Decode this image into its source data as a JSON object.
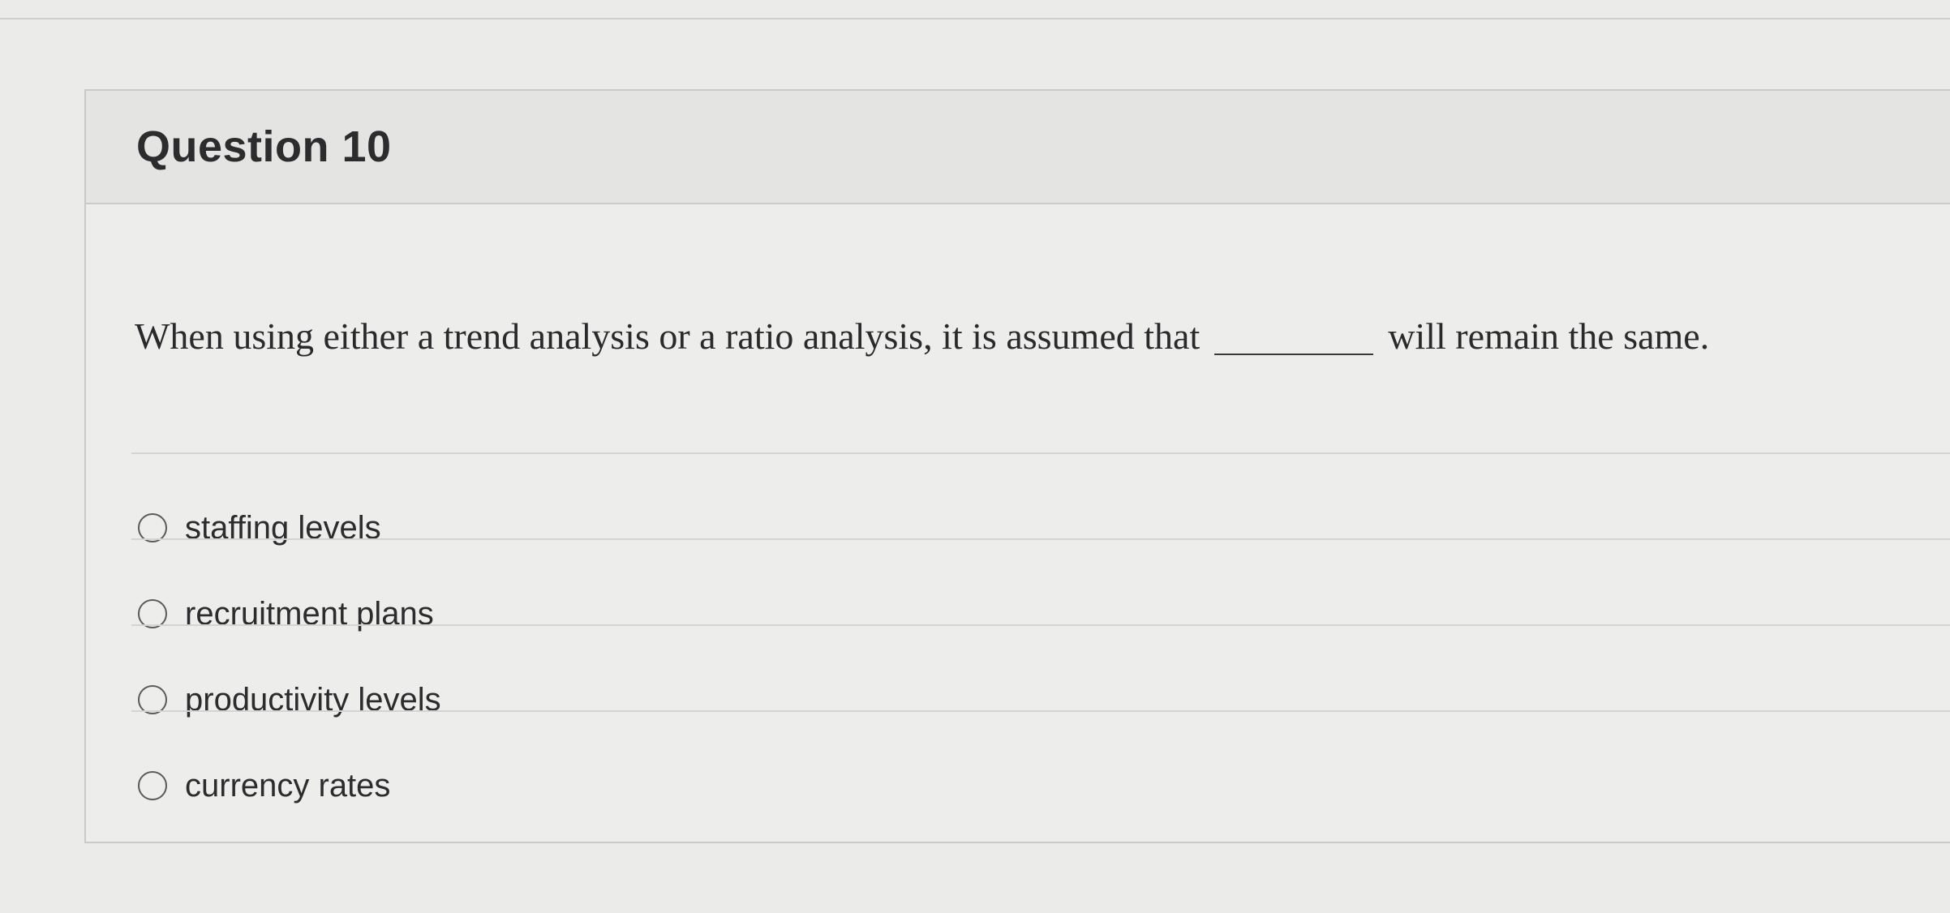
{
  "question": {
    "title": "Question 10",
    "text_before": "When using either a trend analysis or a ratio analysis, it is assumed that",
    "text_after": "will remain the same.",
    "options": [
      {
        "label": "staffing levels",
        "selected": false
      },
      {
        "label": "recruitment plans",
        "selected": false
      },
      {
        "label": "productivity levels",
        "selected": false
      },
      {
        "label": "currency rates",
        "selected": false
      }
    ]
  }
}
